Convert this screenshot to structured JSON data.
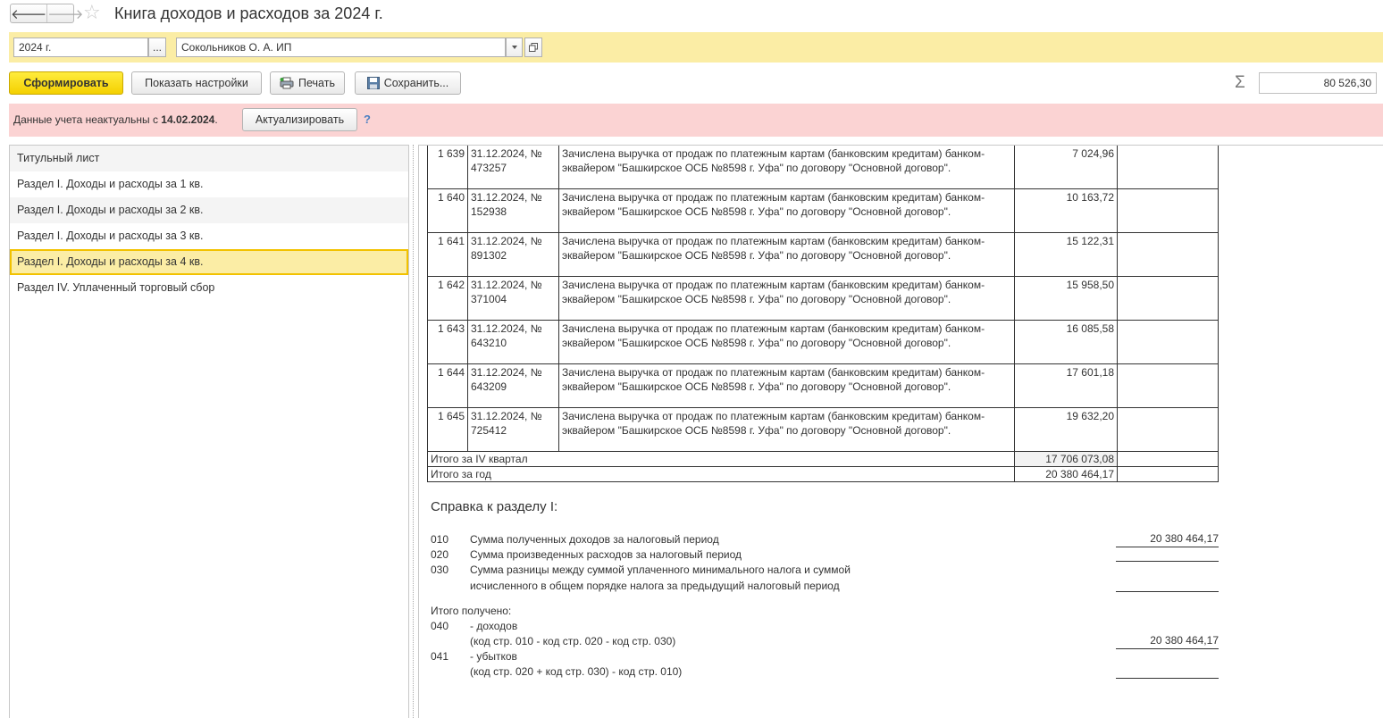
{
  "window": {
    "title": "Книга доходов и расходов за 2024 г.",
    "back_icon": "arrow-left-icon",
    "forward_icon": "arrow-right-icon",
    "favorite_icon": "star-icon"
  },
  "params": {
    "period": "2024 г.",
    "period_button": "...",
    "organization": "Сокольников О. А. ИП"
  },
  "toolbar": {
    "generate_label": "Сформировать",
    "settings_label": "Показать настройки",
    "print_label": "Печать",
    "save_label": "Сохранить...",
    "sum_symbol": "Σ",
    "sum_value": "80 526,30"
  },
  "warning": {
    "text": "Данные учета неактуальны с ",
    "date": "14.02.2024",
    "text_end": ".",
    "actualize_label": "Актуализировать",
    "help": "?"
  },
  "sections": [
    {
      "label": "Титульный лист"
    },
    {
      "label": "Раздел I. Доходы и расходы за 1 кв."
    },
    {
      "label": "Раздел I. Доходы и расходы за 2 кв."
    },
    {
      "label": "Раздел I. Доходы и расходы за 3 кв."
    },
    {
      "label": "Раздел I. Доходы и расходы за 4 кв."
    },
    {
      "label": "Раздел IV. Уплаченный торговый сбор"
    }
  ],
  "selected_section": 4,
  "entries": [
    {
      "num": "1 639",
      "doc": "31.12.2024, № 473257",
      "desc": "Зачислена выручка от продаж по платежным картам (банковским кредитам) банком-эквайером \"Башкирское ОСБ №8598 г. Уфа\" по договору \"Основной договор\".",
      "income": "7 024,96",
      "expense": ""
    },
    {
      "num": "1 640",
      "doc": "31.12.2024, № 152938",
      "desc": "Зачислена выручка от продаж по платежным картам (банковским кредитам) банком-эквайером \"Башкирское ОСБ №8598 г. Уфа\" по договору \"Основной договор\".",
      "income": "10 163,72",
      "expense": ""
    },
    {
      "num": "1 641",
      "doc": "31.12.2024, № 891302",
      "desc": "Зачислена выручка от продаж по платежным картам (банковским кредитам) банком-эквайером \"Башкирское ОСБ №8598 г. Уфа\" по договору \"Основной договор\".",
      "income": "15 122,31",
      "expense": ""
    },
    {
      "num": "1 642",
      "doc": "31.12.2024, № 371004",
      "desc": "Зачислена выручка от продаж по платежным картам (банковским кредитам) банком-эквайером \"Башкирское ОСБ №8598 г. Уфа\" по договору \"Основной договор\".",
      "income": "15 958,50",
      "expense": ""
    },
    {
      "num": "1 643",
      "doc": "31.12.2024, № 643210",
      "desc": "Зачислена выручка от продаж по платежным картам (банковским кредитам) банком-эквайером \"Башкирское ОСБ №8598 г. Уфа\" по договору \"Основной договор\".",
      "income": "16 085,58",
      "expense": ""
    },
    {
      "num": "1 644",
      "doc": "31.12.2024, № 643209",
      "desc": "Зачислена выручка от продаж по платежным картам (банковским кредитам) банком-эквайером \"Башкирское ОСБ №8598 г. Уфа\" по договору \"Основной договор\".",
      "income": "17 601,18",
      "expense": ""
    },
    {
      "num": "1 645",
      "doc": "31.12.2024, № 725412",
      "desc": "Зачислена выручка от продаж по платежным картам (банковским кредитам) банком-эквайером \"Башкирское ОСБ №8598 г. Уфа\" по договору \"Основной договор\".",
      "income": "19 632,20",
      "expense": ""
    }
  ],
  "totals": [
    {
      "label": "Итого за IV квартал",
      "income": "17 706 073,08",
      "expense": ""
    },
    {
      "label": "Итого за год",
      "income": "20 380 464,17",
      "expense": ""
    }
  ],
  "reference": {
    "title": "Справка к разделу I:",
    "line_010_code": "010",
    "line_010_text": "Сумма полученных доходов за налоговый период",
    "line_010_value": "20 380 464,17",
    "line_020_code": "020",
    "line_020_text": "Сумма произведенных  расходов за налоговый период",
    "line_020_value": "",
    "line_030_code": "030",
    "line_030_text_1": "Сумма разницы между  суммой уплаченного минимального налога и суммой",
    "line_030_text_2": "исчисленного в общем порядке налога за предыдущий налоговый период",
    "line_030_value": "",
    "total_heading": "Итого получено:",
    "line_040_code": "040",
    "line_040_text_1": "- доходов",
    "line_040_text_2": "(код стр. 010 - код  стр. 020 - код стр. 030)",
    "line_040_value": "20 380 464,17",
    "line_041_code": "041",
    "line_041_text_1": "- убытков",
    "line_041_text_2": "(код стр. 020 + код  стр. 030) - код стр. 010)",
    "line_041_value": ""
  }
}
